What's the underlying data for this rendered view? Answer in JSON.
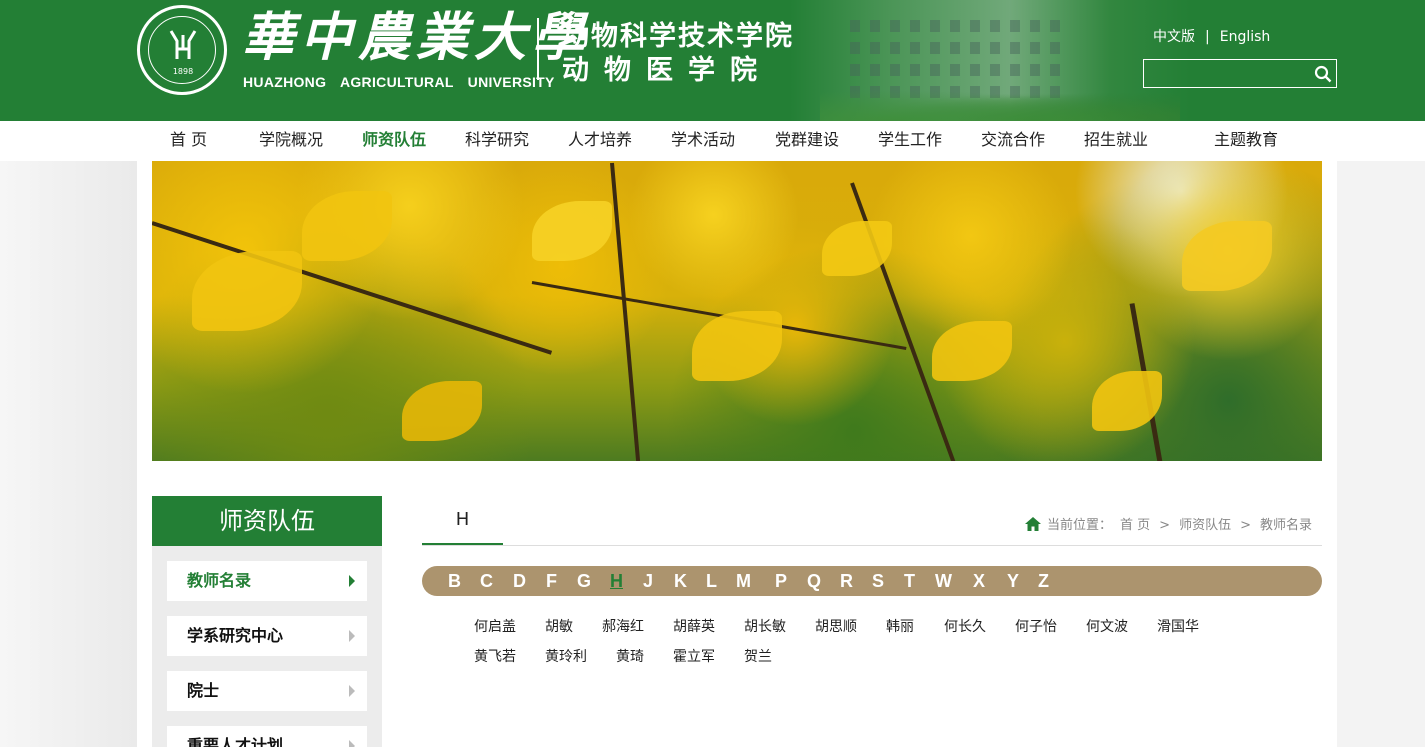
{
  "header": {
    "univ_cn": "華中農業大學",
    "univ_en": "HUAZHONG AGRICULTURAL UNIVERSITY",
    "seal_year": "1898",
    "college_line1": "动物科学技术学院",
    "college_line2": "动物医学院",
    "lang_cn": "中文版",
    "lang_sep": "|",
    "lang_en": "English",
    "search_placeholder": ""
  },
  "nav": {
    "items": [
      "首 页",
      "学院概况",
      "师资队伍",
      "科学研究",
      "人才培养",
      "学术活动",
      "党群建设",
      "学生工作",
      "交流合作",
      "招生就业",
      "主题教育"
    ],
    "active_index": 2
  },
  "sidebar": {
    "title": "师资队伍",
    "items": [
      "教师名录",
      "学系研究中心",
      "院士",
      "重要人才计划"
    ],
    "active_index": 0
  },
  "tab": {
    "label": "H"
  },
  "breadcrumb": {
    "prefix": "当前位置：",
    "items": [
      "首 页",
      "师资队伍",
      "教师名录"
    ],
    "sep": ">"
  },
  "letters": {
    "items": [
      "B",
      "C",
      "D",
      "F",
      "G",
      "H",
      "J",
      "K",
      "L",
      "M",
      "P",
      "Q",
      "R",
      "S",
      "T",
      "W",
      "X",
      "Y",
      "Z"
    ],
    "active": "H"
  },
  "teachers": {
    "row1": [
      "何启盖",
      "胡敏",
      "郝海红",
      "胡薛英",
      "胡长敏",
      "胡思顺",
      "韩丽",
      "何长久",
      "何子怡",
      "何文波",
      "滑国华"
    ],
    "row2": [
      "黄飞若",
      "黄玲利",
      "黄琦",
      "霍立军",
      "贺兰"
    ]
  },
  "colors": {
    "brand_green": "#237f35",
    "letter_bar": "#ac946e"
  }
}
